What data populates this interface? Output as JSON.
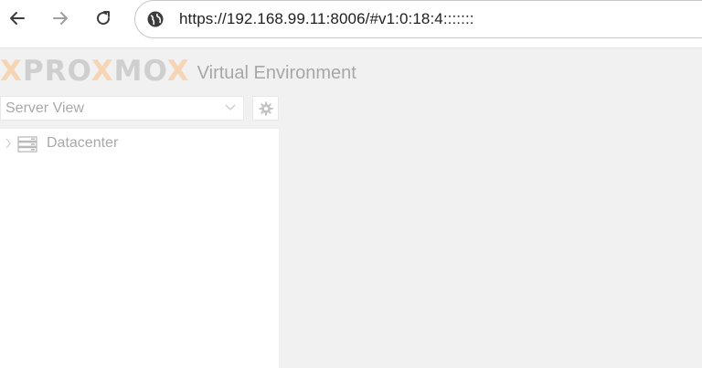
{
  "browser": {
    "url": "https://192.168.99.11:8006/#v1:0:18:4:::::::",
    "back_icon": "arrow-left-icon",
    "forward_icon": "arrow-right-icon",
    "reload_icon": "reload-icon",
    "site_icon": "globe-icon"
  },
  "app": {
    "logo_text": {
      "part1": "",
      "x1": "X",
      "part2": "PRO",
      "x2": "X",
      "part3": "MO",
      "x3": "X"
    },
    "subtitle": "Virtual Environment",
    "colors": {
      "logo_x": "#f6d5b5",
      "logo_text": "#cfcfcf",
      "background": "#f1f1f1"
    }
  },
  "sidebar": {
    "view_select_value": "Server View",
    "gear_icon": "gear-icon",
    "tree": [
      {
        "label": "Datacenter",
        "icon": "server-icon",
        "expander_icon": "chevron-right-icon"
      }
    ]
  }
}
